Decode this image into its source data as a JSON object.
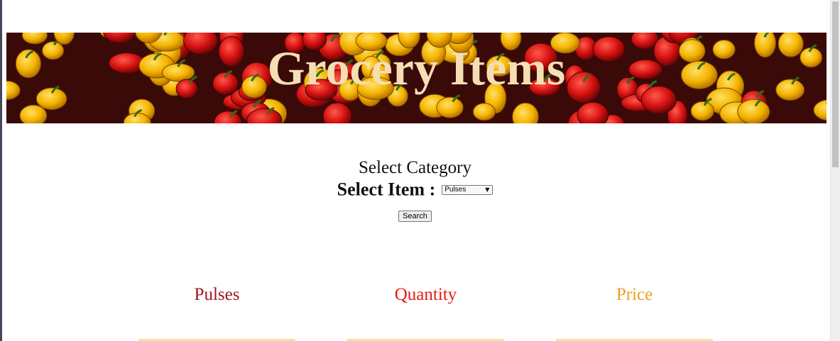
{
  "banner": {
    "title": "Grocery Items"
  },
  "form": {
    "category_title": "Select Category",
    "item_label": "Select Item :",
    "item_select_value": "Pulses",
    "search_label": "Search"
  },
  "columns": [
    {
      "label": "Pulses",
      "color": "#a3141c"
    },
    {
      "label": "Quantity",
      "color": "#e81a12"
    },
    {
      "label": "Price",
      "color": "#f0a020"
    }
  ],
  "colors": {
    "title": "#f5deb3",
    "column_bar": "#f4dfb0"
  }
}
